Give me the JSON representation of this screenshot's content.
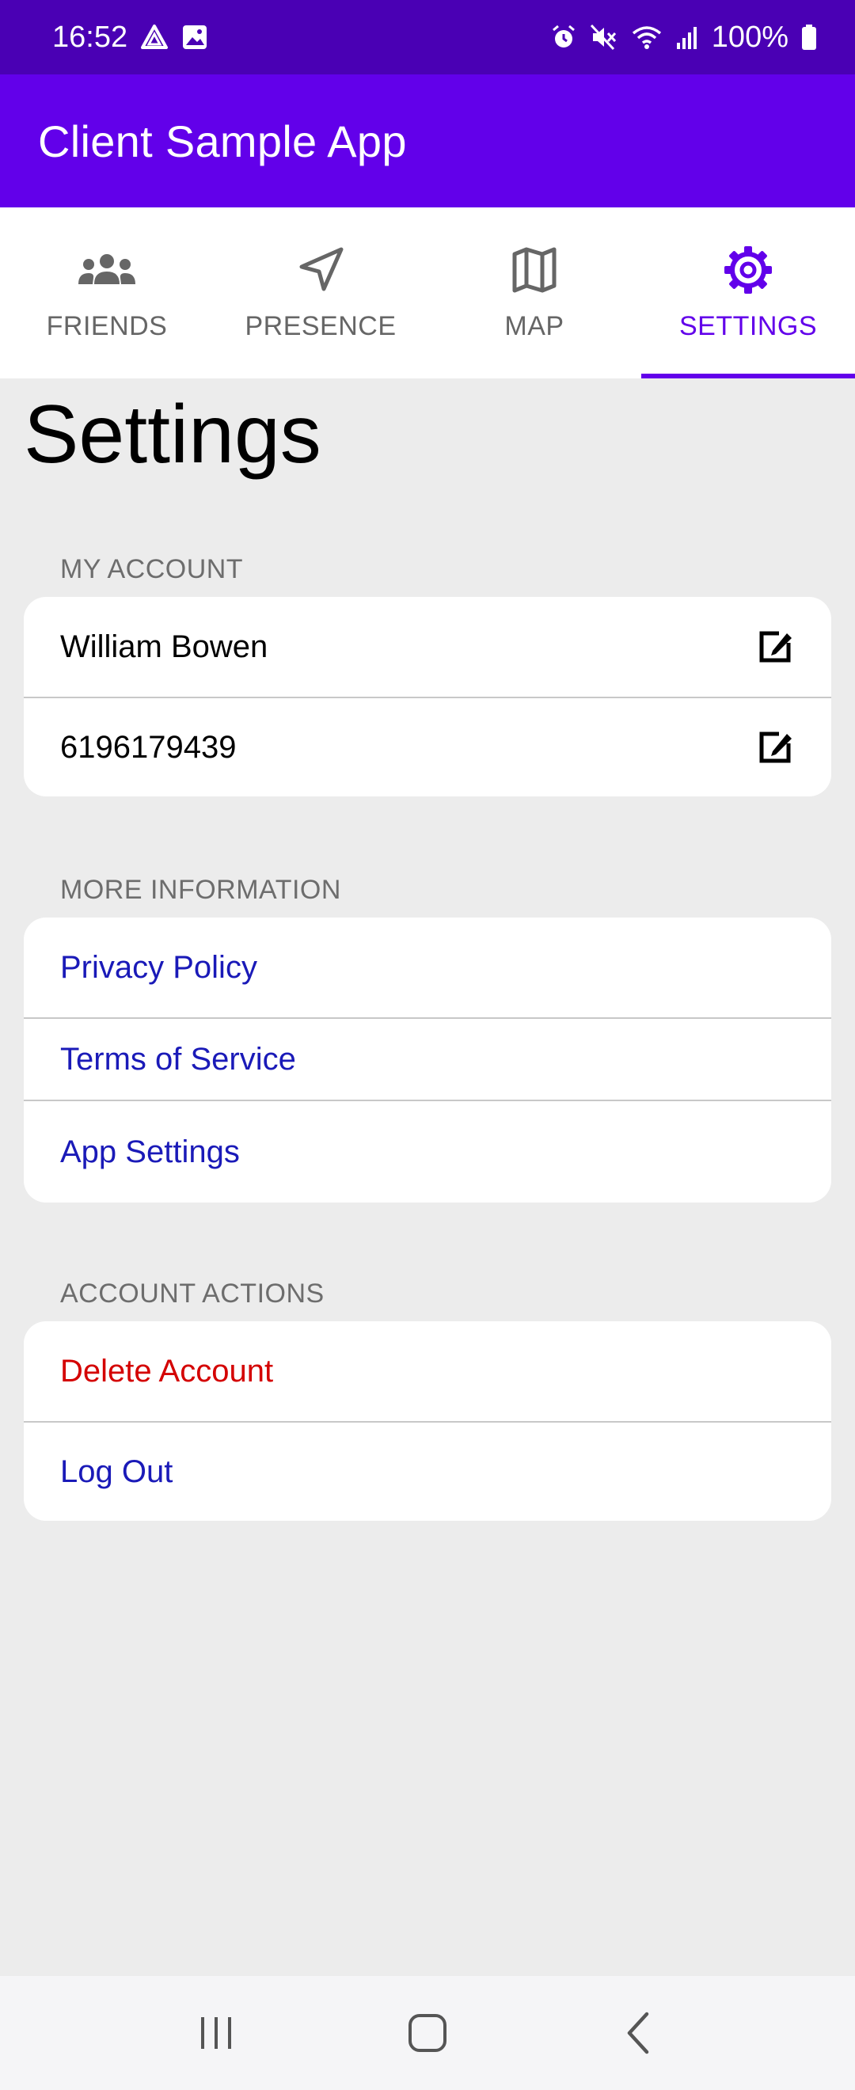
{
  "status_bar": {
    "time": "16:52",
    "battery": "100%",
    "left_icons": [
      "drive-icon",
      "image-icon"
    ],
    "right_icons": [
      "alarm-icon",
      "mute-icon",
      "wifi-icon",
      "signal-icon",
      "battery-icon"
    ]
  },
  "app_bar": {
    "title": "Client Sample App"
  },
  "tabs": [
    {
      "label": "FRIENDS",
      "icon": "people-icon",
      "active": false
    },
    {
      "label": "PRESENCE",
      "icon": "navigation-icon",
      "active": false
    },
    {
      "label": "MAP",
      "icon": "map-icon",
      "active": false
    },
    {
      "label": "SETTINGS",
      "icon": "gear-icon",
      "active": true
    }
  ],
  "page": {
    "title": "Settings"
  },
  "sections": {
    "my_account": {
      "header": "MY ACCOUNT",
      "rows": [
        {
          "label": "William Bowen",
          "icon": "edit-icon"
        },
        {
          "label": "6196179439",
          "icon": "edit-icon"
        }
      ]
    },
    "more_information": {
      "header": "MORE INFORMATION",
      "rows": [
        {
          "label": "Privacy Policy"
        },
        {
          "label": "Terms of Service"
        },
        {
          "label": "App Settings"
        }
      ]
    },
    "account_actions": {
      "header": "ACCOUNT ACTIONS",
      "rows": [
        {
          "label": "Delete Account"
        },
        {
          "label": "Log Out"
        }
      ]
    }
  },
  "nav_bar": {
    "buttons": [
      "recent-apps-icon",
      "home-icon",
      "back-icon"
    ]
  },
  "colors": {
    "status_bar": "#4a00b4",
    "primary": "#6200ea",
    "link": "#1a1ab8",
    "danger": "#d40000",
    "background": "#ececec"
  }
}
